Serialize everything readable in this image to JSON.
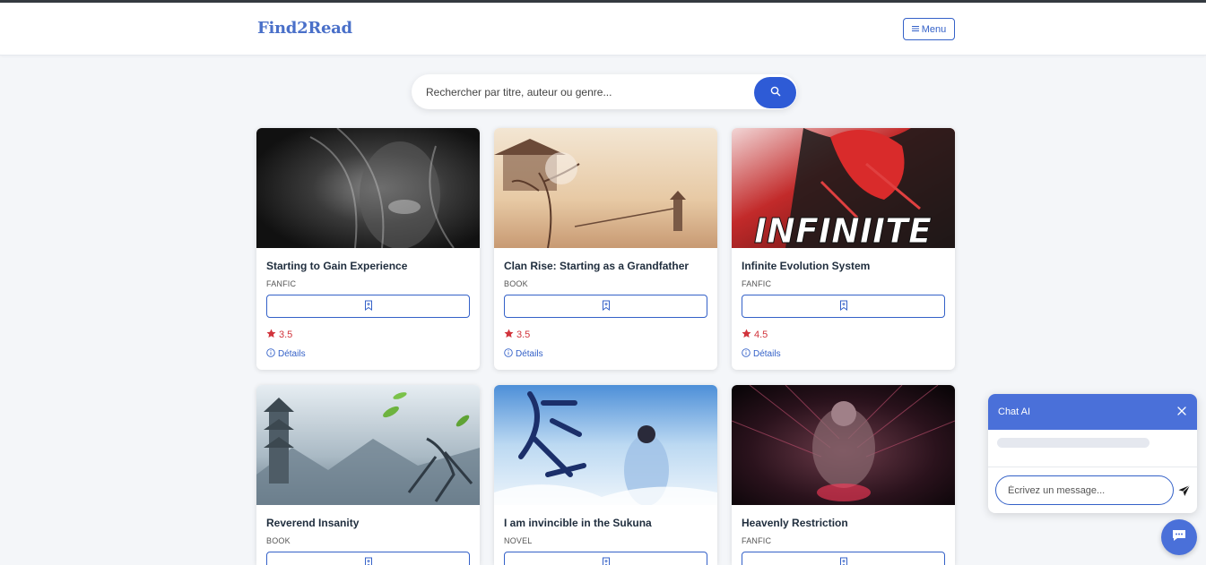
{
  "navbar": {
    "brand": "Find2Read",
    "menu_label": "Menu"
  },
  "search": {
    "placeholder": "Rechercher par titre, auteur ou genre..."
  },
  "books": [
    {
      "title": "Starting to Gain Experience",
      "type": "FANFIC",
      "rating": "3.5",
      "details_label": "Détails"
    },
    {
      "title": "Clan Rise: Starting as a Grandfather",
      "type": "BOOK",
      "rating": "3.5",
      "details_label": "Détails"
    },
    {
      "title": "Infinite Evolution System",
      "type": "FANFIC",
      "rating": "4.5",
      "details_label": "Détails",
      "cover_text": "INFINIITE"
    },
    {
      "title": "Reverend Insanity",
      "type": "BOOK"
    },
    {
      "title": "I am invincible in the Sukuna",
      "type": "NOVEL"
    },
    {
      "title": "Heavenly Restriction",
      "type": "FANFIC"
    }
  ],
  "chat": {
    "title": "Chat AI",
    "input_placeholder": "Écrivez un message..."
  },
  "colors": {
    "accent": "#3461c8",
    "chat_header": "#4a70d9",
    "rating": "#d1343c"
  },
  "icons": {
    "menu": "hamburger-icon",
    "search": "search-icon",
    "bookmark": "bookmark-add-icon",
    "star": "star-icon",
    "info": "info-icon",
    "close": "close-icon",
    "send": "send-icon",
    "chat": "chat-bubble-icon"
  }
}
